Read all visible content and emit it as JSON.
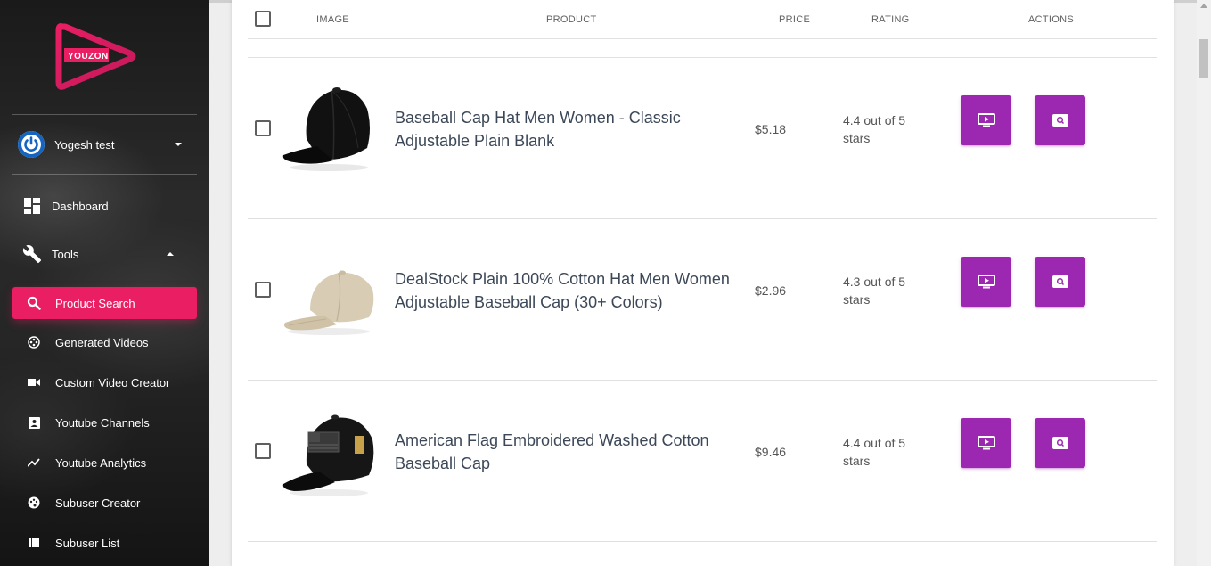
{
  "brand": {
    "logo_text": "YOUZON",
    "accent": "#e91e63",
    "secondary": "#9c27b0"
  },
  "user": {
    "name": "Yogesh test",
    "icon": "power-icon"
  },
  "nav": {
    "dashboard": {
      "label": "Dashboard",
      "icon": "dashboard-icon"
    },
    "tools": {
      "label": "Tools",
      "icon": "wrench-icon"
    },
    "items": [
      {
        "label": "Product Search",
        "icon": "search-icon",
        "active": true
      },
      {
        "label": "Generated Videos",
        "icon": "film-reel-icon"
      },
      {
        "label": "Custom Video Creator",
        "icon": "video-camera-icon"
      },
      {
        "label": "Youtube Channels",
        "icon": "account-box-icon"
      },
      {
        "label": "Youtube Analytics",
        "icon": "trending-up-icon"
      },
      {
        "label": "Subuser Creator",
        "icon": "palette-icon"
      },
      {
        "label": "Subuser List",
        "icon": "list-icon"
      }
    ]
  },
  "table": {
    "headers": {
      "image": "IMAGE",
      "product": "PRODUCT",
      "price": "PRICE",
      "rating": "RATING",
      "actions": "ACTIONS"
    },
    "rows": [
      {
        "title": "Baseball Cap Hat Men Women - Classic Adjustable Plain Blank",
        "price": "$5.18",
        "rating": "4.4 out of 5 stars",
        "image": "black-cap"
      },
      {
        "title": "DealStock Plain 100% Cotton Hat Men Women Adjustable Baseball Cap (30+ Colors)",
        "price": "$2.96",
        "rating": "4.3 out of 5 stars",
        "image": "khaki-cap"
      },
      {
        "title": "American Flag Embroidered Washed Cotton Baseball Cap",
        "price": "$9.46",
        "rating": "4.4 out of 5 stars",
        "image": "flag-cap"
      }
    ]
  }
}
